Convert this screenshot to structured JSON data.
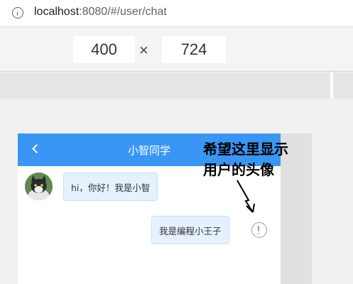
{
  "browser": {
    "url_host": "localhost",
    "url_rest": ":8080/#/user/chat"
  },
  "device_toolbar": {
    "width": "400",
    "height": "724",
    "separator": "×"
  },
  "chat": {
    "back_icon": "chevron-left-icon",
    "title": "小智同学",
    "messages": [
      {
        "side": "left",
        "text": "hi，你好！我是小智"
      },
      {
        "side": "right",
        "text": "我是编程小王子"
      }
    ]
  },
  "annotation": {
    "line1": "希望这里显示",
    "line2": "用户的头像"
  },
  "colors": {
    "navbar": "#3a96f5",
    "bubble": "#e5f1fd"
  }
}
